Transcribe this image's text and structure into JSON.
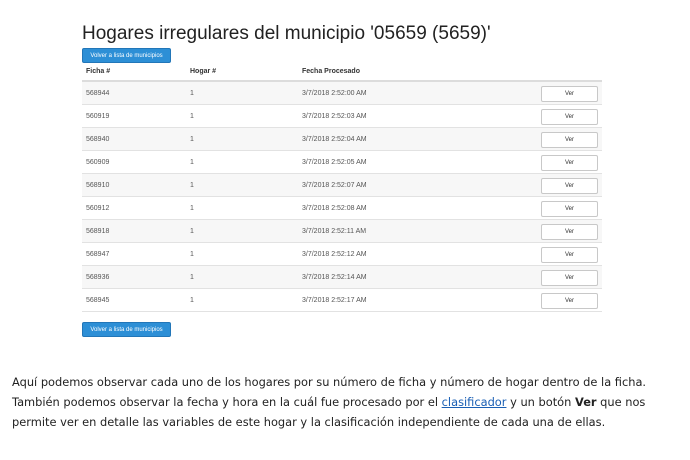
{
  "page": {
    "title": "Hogares irregulares del municipio '05659 (5659)'",
    "back_button_label": "Volver a lista de municipios"
  },
  "table": {
    "headers": [
      "Ficha #",
      "Hogar #",
      "Fecha Procesado"
    ],
    "action_label": "Ver",
    "rows": [
      {
        "ficha": "568944",
        "hogar": "1",
        "fecha": "3/7/2018 2:52:00 AM"
      },
      {
        "ficha": "560919",
        "hogar": "1",
        "fecha": "3/7/2018 2:52:03 AM"
      },
      {
        "ficha": "568940",
        "hogar": "1",
        "fecha": "3/7/2018 2:52:04 AM"
      },
      {
        "ficha": "560909",
        "hogar": "1",
        "fecha": "3/7/2018 2:52:05 AM"
      },
      {
        "ficha": "568910",
        "hogar": "1",
        "fecha": "3/7/2018 2:52:07 AM"
      },
      {
        "ficha": "560912",
        "hogar": "1",
        "fecha": "3/7/2018 2:52:08 AM"
      },
      {
        "ficha": "568918",
        "hogar": "1",
        "fecha": "3/7/2018 2:52:11 AM"
      },
      {
        "ficha": "568947",
        "hogar": "1",
        "fecha": "3/7/2018 2:52:12 AM"
      },
      {
        "ficha": "568936",
        "hogar": "1",
        "fecha": "3/7/2018 2:52:14 AM"
      },
      {
        "ficha": "568945",
        "hogar": "1",
        "fecha": "3/7/2018 2:52:17 AM"
      }
    ]
  },
  "description": {
    "part1": "Aquí podemos observar cada uno de los hogares por su número de ficha y número de hogar dentro de la ficha. También podemos observar la fecha y hora en la cuál fue procesado por el ",
    "link": "clasificador",
    "part2": " y un botón ",
    "bold": "Ver",
    "part3": " que nos permite ver en detalle las variables de este hogar y la clasificación independiente de cada una de ellas."
  }
}
